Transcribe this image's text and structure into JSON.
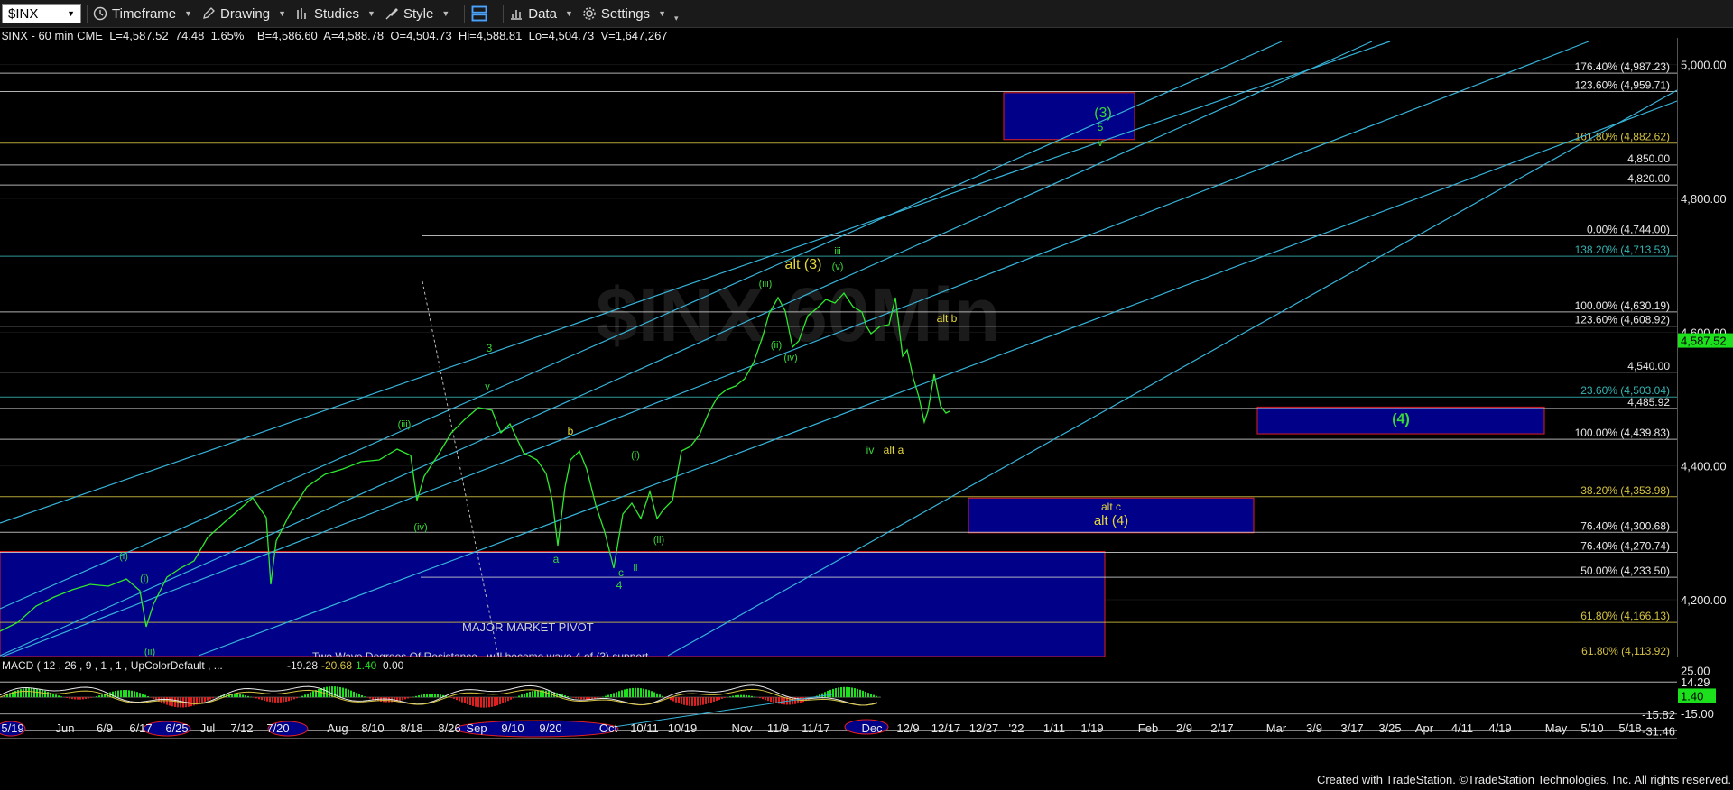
{
  "toolbar": {
    "symbol": "$INX",
    "items": [
      {
        "label": "Timeframe",
        "icon": "clock-icon"
      },
      {
        "label": "Drawing",
        "icon": "pencil-icon"
      },
      {
        "label": "Studies",
        "icon": "studies-icon"
      },
      {
        "label": "Style",
        "icon": "style-icon"
      },
      {
        "label": "Data",
        "icon": "data-icon"
      },
      {
        "label": "Settings",
        "icon": "gear-icon"
      }
    ]
  },
  "info_line": "$INX - 60 min CME  L=4,587.52  74.48  1.65%    B=4,586.60  A=4,588.78  O=4,504.73  Hi=4,588.81  Lo=4,504.73  V=1,647,267",
  "footer": "Created with TradeStation. ©TradeStation Technologies, Inc. All rights reserved.",
  "watermark": "$INX 60Min",
  "colors": {
    "price": "#2ee82e",
    "channel": "#36b3d9",
    "yellow_label": "#e5d93a",
    "green_label": "#38d838",
    "box_fill": "#000088",
    "box_border": "#e02020",
    "last_price_bg": "#1de01d",
    "macd_hist_pos": "#1ee01e",
    "macd_hist_neg": "#e01e1e"
  },
  "chart_data": [
    {
      "type": "line",
      "series": [
        {
          "name": "$INX"
        }
      ],
      "x_tick_labels": [
        "5/19",
        "Jun",
        "6/9",
        "6/17",
        "6/25",
        "Jul",
        "7/12",
        "7/20",
        "Aug",
        "8/10",
        "8/18",
        "8/26",
        "Sep",
        "9/10",
        "9/20",
        "Oct",
        "10/11",
        "10/19",
        "Nov",
        "11/9",
        "11/17",
        "Dec",
        "12/9",
        "12/17",
        "12/27",
        "'22",
        "1/11",
        "1/19",
        "Feb",
        "2/9",
        "2/17",
        "Mar",
        "3/9",
        "3/17",
        "3/25",
        "Apr",
        "4/11",
        "4/19",
        "May",
        "5/10",
        "5/18"
      ],
      "y_tick_labels": [
        "5,000.00",
        "4,800.00",
        "4,600.00",
        "4,400.00",
        "4,200.00"
      ],
      "ylim": [
        4115,
        5040
      ],
      "last_price": "4,587.52",
      "levels": [
        {
          "label": "176.40% (4,987.23)",
          "value": 4987.23
        },
        {
          "label": "123.60% (4,959.71)",
          "value": 4959.71
        },
        {
          "label": "161.80% (4,882.62)",
          "value": 4882.62
        },
        {
          "label": "4,850.00",
          "value": 4850.0
        },
        {
          "label": "4,820.00",
          "value": 4820.0
        },
        {
          "label": "0.00% (4,744.00)",
          "value": 4744.0
        },
        {
          "label": "138.20% (4,713.53)",
          "value": 4713.53
        },
        {
          "label": "100.00% (4,630.19)",
          "value": 4630.19
        },
        {
          "label": "123.60% (4,608.92)",
          "value": 4608.92
        },
        {
          "label": "4,540.00",
          "value": 4540.0
        },
        {
          "label": "23.60% (4,503.04)",
          "value": 4503.04
        },
        {
          "label": "4,485.92",
          "value": 4485.92
        },
        {
          "label": "100.00% (4,439.83)",
          "value": 4439.83
        },
        {
          "label": "38.20% (4,353.98)",
          "value": 4353.98
        },
        {
          "label": "76.40% (4,300.68)",
          "value": 4300.68
        },
        {
          "label": "76.40% (4,270.74)",
          "value": 4270.74
        },
        {
          "label": "50.00% (4,233.50)",
          "value": 4233.5
        },
        {
          "label": "61.80% (4,166.13)",
          "value": 4166.13
        },
        {
          "label": "61.80% (4,113.92)",
          "value": 4113.92
        }
      ],
      "zones": [
        {
          "label": "",
          "from": 4958,
          "to": 4888
        },
        {
          "label": "(4)",
          "from": 4488,
          "to": 4448
        },
        {
          "label": "alt c",
          "sublabel": "alt (4)",
          "from": 4352,
          "to": 4300
        },
        {
          "label": "MAJOR MARKET PIVOT",
          "from": 4272,
          "to": 4115
        }
      ],
      "annotations": [
        "(3)",
        "5",
        "v",
        "alt (3)",
        "iii",
        "(v)",
        "(iii)",
        "(iv)",
        "alt b",
        "3",
        "v",
        "(iii)",
        "(iv)",
        "b",
        "(i)",
        "(ii)",
        "a",
        "c",
        "4",
        "ii",
        "(i)",
        "(ii)",
        "iv",
        "alt a",
        "(i)",
        "(ii)",
        "Two Wave Degrees Of Resistance - will become wave 4 of (3) support"
      ]
    },
    {
      "type": "bar",
      "title": "MACD ( 12 , 26 , 9 , 1 , 1 , UpColorDefault , ...",
      "values": [
        -19.28,
        -20.68,
        1.4,
        0.0
      ],
      "value_labels": [
        "-19.28",
        "-20.68",
        "1.40",
        "0.00"
      ],
      "y_tick_labels": [
        "25.00",
        "14.29",
        "1.40",
        "-15.82",
        "-15.00",
        "-31.46"
      ],
      "ylim": [
        -38,
        28
      ]
    }
  ]
}
